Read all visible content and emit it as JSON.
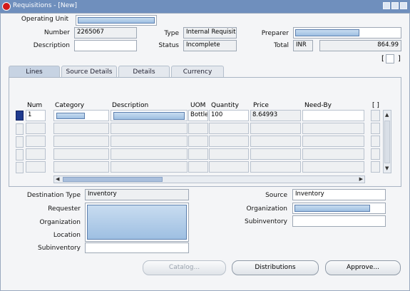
{
  "window": {
    "title": "Requisitions - [New]"
  },
  "header": {
    "operating_unit_label": "Operating Unit",
    "number_label": "Number",
    "number_value": "2265067",
    "type_label": "Type",
    "type_value": "Internal Requisit",
    "preparer_label": "Preparer",
    "description_label": "Description",
    "description_value": "",
    "status_label": "Status",
    "status_value": "Incomplete",
    "total_label": "Total",
    "currency_value": "INR",
    "total_value": "864.99",
    "bracket_left": "[",
    "bracket_right": "]"
  },
  "tabs": [
    {
      "label": "Lines"
    },
    {
      "label": "Source Details"
    },
    {
      "label": "Details"
    },
    {
      "label": "Currency"
    }
  ],
  "lines": {
    "columns": [
      "Num",
      "Category",
      "Description",
      "UOM",
      "Quantity",
      "Price",
      "Need-By",
      "[ ]"
    ],
    "rows": [
      {
        "num": "1",
        "category": "",
        "description": "",
        "uom": "Bottle",
        "quantity": "100",
        "price": "8.64993",
        "need_by": ""
      }
    ]
  },
  "footer": {
    "destination_type_label": "Destination Type",
    "destination_type_value": "Inventory",
    "requester_label": "Requester",
    "organization_label": "Organization",
    "location_label": "Location",
    "subinventory_label": "Subinventory",
    "source_label": "Source",
    "source_value": "Inventory",
    "src_organization_label": "Organization",
    "src_subinventory_label": "Subinventory"
  },
  "buttons": {
    "catalog": "Catalog...",
    "distributions": "Distributions",
    "approve": "Approve..."
  }
}
